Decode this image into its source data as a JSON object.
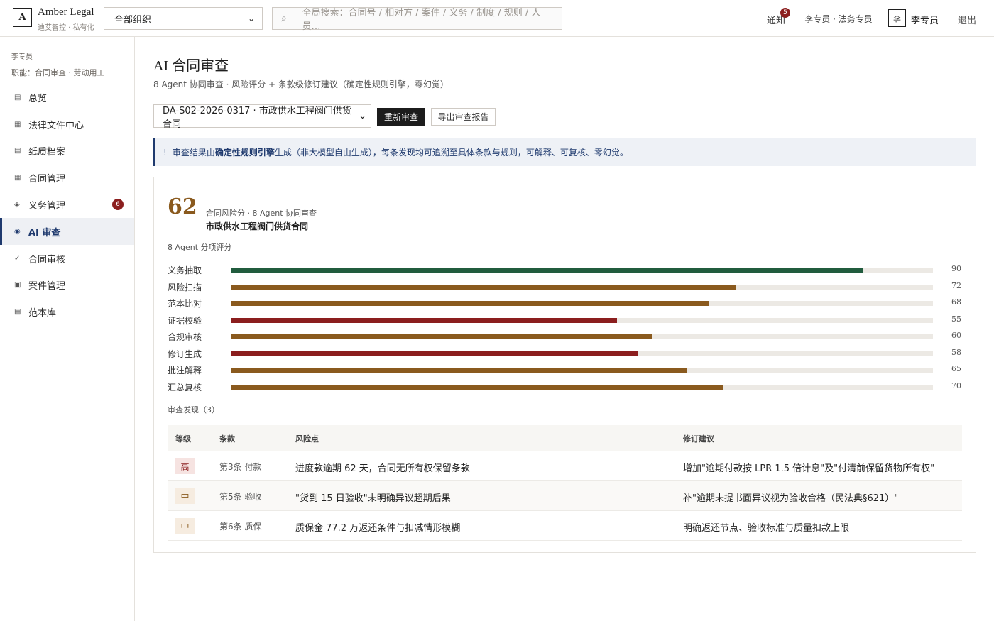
{
  "header": {
    "logo_letter": "A",
    "brand_name": "Amber Legal",
    "brand_sub": "迪艾智控 · 私有化",
    "org_select": "全部组织",
    "search_placeholder": "全局搜索：合同号 / 相对方 / 案件 / 义务 / 制度 / 规则 / 人员…",
    "notify_label": "通知",
    "notify_count": "5",
    "role_button": "李专员 · 法务专员",
    "avatar_letter": "李",
    "username": "李专员",
    "logout": "退出"
  },
  "sidebar": {
    "user": "李专员",
    "role": "职能：合同审查 · 劳动用工",
    "items": [
      {
        "label": "总览",
        "icon": "list-icon"
      },
      {
        "label": "法律文件中心",
        "icon": "grid-icon"
      },
      {
        "label": "纸质档案",
        "icon": "archive-icon"
      },
      {
        "label": "合同管理",
        "icon": "contract-icon"
      },
      {
        "label": "义务管理",
        "icon": "diamond-icon",
        "badge": "6"
      },
      {
        "label": "AI 审查",
        "icon": "target-icon",
        "active": true
      },
      {
        "label": "合同审核",
        "icon": "check-icon"
      },
      {
        "label": "案件管理",
        "icon": "case-icon"
      },
      {
        "label": "范本库",
        "icon": "template-icon"
      }
    ]
  },
  "main": {
    "title": "AI 合同审查",
    "subtitle": "8 Agent 协同审查 · 风险评分 + 条款级修订建议（确定性规则引擎，零幻觉）",
    "contract_select": "DA-S02-2026-0317 · 市政供水工程阀门供货合同",
    "rerun_button": "重新审查",
    "export_button": "导出审查报告",
    "notice": {
      "bang": "!",
      "prefix": "审查结果由",
      "bold": "确定性规则引擎",
      "suffix": "生成（非大模型自由生成），每条发现均可追溯至具体条款与规则，可解释、可复核、零幻觉。"
    },
    "score": "62",
    "score_label": "合同风险分 · 8 Agent 协同审查",
    "score_contract": "市政供水工程阀门供货合同",
    "agents_title": "8 Agent 分项评分",
    "agents": [
      {
        "label": "义务抽取",
        "value": 90,
        "color": "#215c3e"
      },
      {
        "label": "风险扫描",
        "value": 72,
        "color": "#8a5a1e"
      },
      {
        "label": "范本比对",
        "value": 68,
        "color": "#8a5a1e"
      },
      {
        "label": "证据校验",
        "value": 55,
        "color": "#8b1e1e"
      },
      {
        "label": "合规审核",
        "value": 60,
        "color": "#8a5a1e"
      },
      {
        "label": "修订生成",
        "value": 58,
        "color": "#8b1e1e"
      },
      {
        "label": "批注解释",
        "value": 65,
        "color": "#8a5a1e"
      },
      {
        "label": "汇总复核",
        "value": 70,
        "color": "#8a5a1e"
      }
    ],
    "findings_title": "审查发现（3）",
    "table": {
      "headers": [
        "等级",
        "条款",
        "风险点",
        "修订建议"
      ],
      "rows": [
        {
          "level": "高",
          "severity": "high",
          "clause": "第3条 付款",
          "risk": "进度款逾期 62 天，合同无所有权保留条款",
          "advice": "增加\"逾期付款按 LPR 1.5 倍计息\"及\"付清前保留货物所有权\""
        },
        {
          "level": "中",
          "severity": "mid",
          "clause": "第5条 验收",
          "risk": "\"货到 15 日验收\"未明确异议超期后果",
          "advice": "补\"逾期未提书面异议视为验收合格（民法典§621）\""
        },
        {
          "level": "中",
          "severity": "mid",
          "clause": "第6条 质保",
          "risk": "质保金 77.2 万返还条件与扣减情形模糊",
          "advice": "明确返还节点、验收标准与质量扣款上限"
        }
      ]
    }
  }
}
